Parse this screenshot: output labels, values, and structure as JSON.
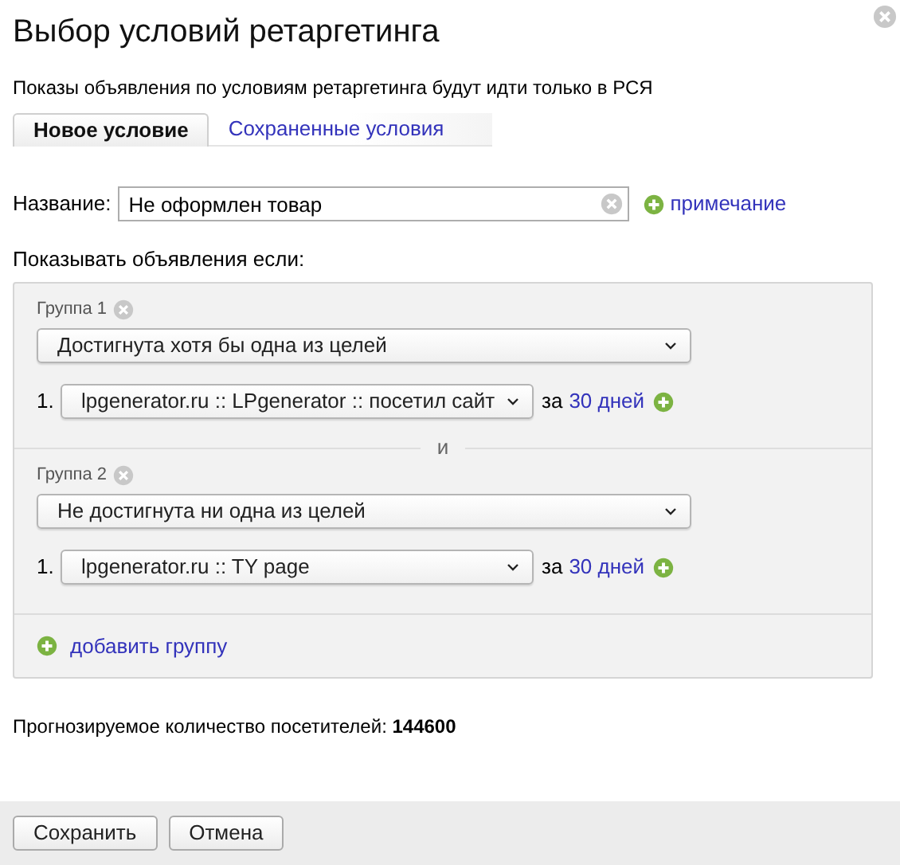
{
  "dialog": {
    "title": "Выбор условий ретаргетинга",
    "notice": "Показы объявления по условиям ретаргетинга будут идти только в РСЯ"
  },
  "tabs": [
    {
      "label": "Новое условие",
      "selected": true
    },
    {
      "label": "Сохраненные условия",
      "selected": false
    }
  ],
  "name_field": {
    "label": "Название:",
    "value": "Не оформлен товар",
    "note_link": "примечание"
  },
  "conditions": {
    "heading": "Показывать объявления если:",
    "separator": "и",
    "groups": [
      {
        "title": "Группа 1",
        "mode": "Достигнута хотя бы одна из целей",
        "goals": [
          {
            "number": "1.",
            "goal": "lpgenerator.ru :: LPgenerator :: посетил сайт",
            "period_prefix": "за",
            "period": "30 дней"
          }
        ]
      },
      {
        "title": "Группа 2",
        "mode": "Не достигнута ни одна из целей",
        "goals": [
          {
            "number": "1.",
            "goal": "lpgenerator.ru :: TY page",
            "period_prefix": "за",
            "period": "30 дней"
          }
        ]
      }
    ],
    "add_group": "добавить группу"
  },
  "forecast": "Прогнозируемое количество посетителей: **144600**",
  "buttons": [
    "Сохранить",
    "Отмена"
  ]
}
